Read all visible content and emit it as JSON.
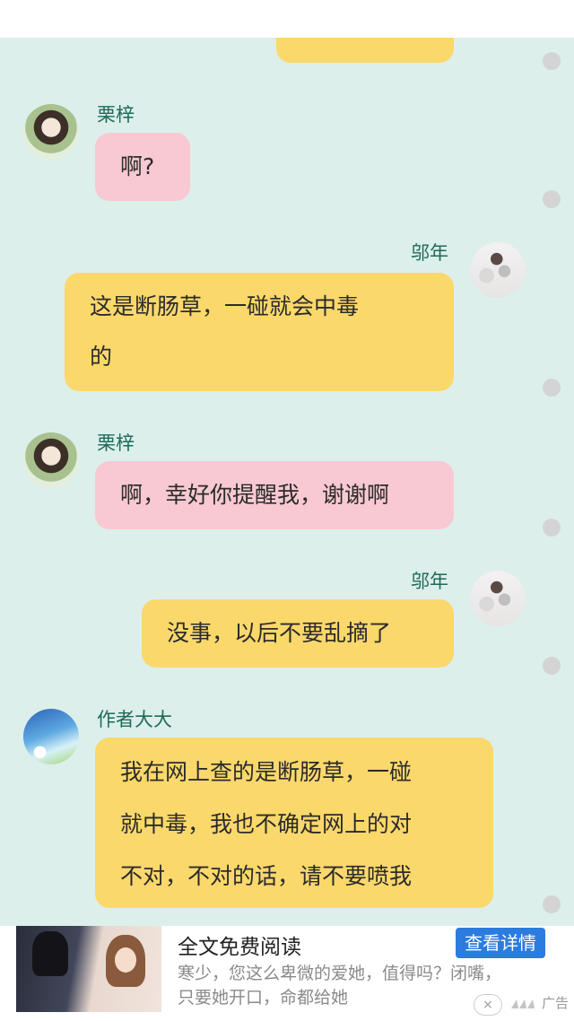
{
  "chat": {
    "messages": [
      {
        "sender": "栗梓",
        "text": "啊?"
      },
      {
        "sender": "邬年",
        "text_line1": "这是断肠草，一碰就会中毒",
        "text_line2": "的"
      },
      {
        "sender": "栗梓",
        "text": "啊，幸好你提醒我，谢谢啊"
      },
      {
        "sender": "邬年",
        "text": "没事，以后不要乱摘了"
      },
      {
        "sender": "作者大大",
        "text_line1": "我在网上查的是断肠草，一碰",
        "text_line2": "就中毒，我也不确定网上的对",
        "text_line3": "不对，不对的话，请不要喷我"
      }
    ]
  },
  "ad": {
    "title": "全文免费阅读",
    "button": "查看详情",
    "desc_line1": "寒少，您这么卑微的爱她，值得吗？闭嘴，",
    "desc_line2": "只要她开口，命都给她",
    "label": "广告",
    "close": "×"
  },
  "colors": {
    "chat_bg": "#dcefeb",
    "pink_bubble": "#f8c9d2",
    "yellow_bubble": "#fbd86b",
    "name_color": "#1f6a5a",
    "ad_button": "#2b7cde"
  },
  "icons": [
    "close-icon",
    "ad-logo-icon"
  ]
}
